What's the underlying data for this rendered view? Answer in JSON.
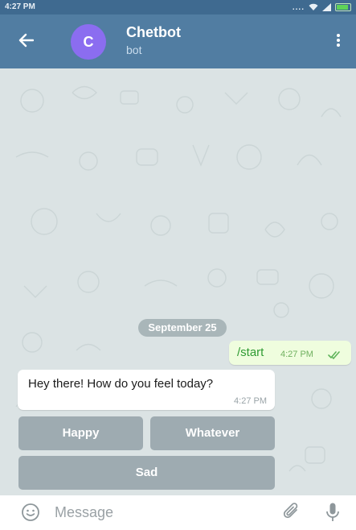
{
  "status_bar": {
    "time": "4:27 PM",
    "indicators": "....",
    "icons": [
      "wifi-icon",
      "signal-icon",
      "battery-icon"
    ]
  },
  "header": {
    "back_icon": "arrow-left-icon",
    "avatar_letter": "C",
    "avatar_color": "#8b6df0",
    "title": "Chetbot",
    "subtitle": "bot",
    "menu_icon": "more-vertical-icon",
    "bar_color": "#517da2"
  },
  "chat": {
    "wallpaper_color": "#dbe3e4",
    "date_label": "September 25",
    "messages": [
      {
        "direction": "outgoing",
        "text": "/start",
        "time": "4:27 PM",
        "status_icon": "double-check-icon"
      },
      {
        "direction": "incoming",
        "text": "Hey there! How do you feel today?",
        "time": "4:27 PM"
      }
    ]
  },
  "keyboard": {
    "buttons": [
      {
        "label": "Happy"
      },
      {
        "label": "Whatever"
      },
      {
        "label": "Sad"
      }
    ]
  },
  "input_bar": {
    "placeholder": "Message",
    "icons": [
      "emoji-icon",
      "attach-icon",
      "mic-icon"
    ]
  }
}
